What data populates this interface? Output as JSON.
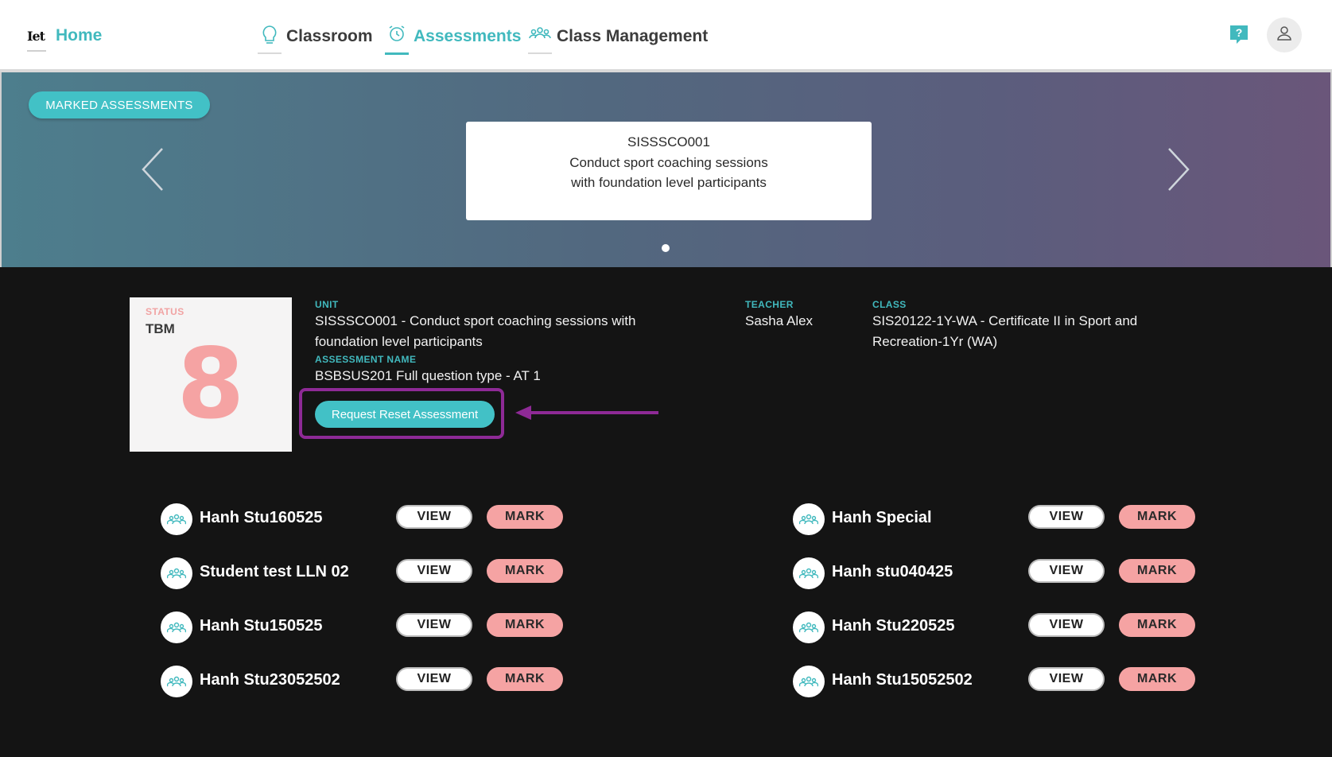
{
  "nav": {
    "logo": "Iet",
    "home": "Home",
    "items": [
      {
        "label": "Classroom",
        "icon": "lightbulb-icon",
        "active": false
      },
      {
        "label": "Assessments",
        "icon": "alarm-clock-icon",
        "active": true
      },
      {
        "label": "Class Management",
        "icon": "users-group-icon",
        "active": false
      }
    ],
    "help_icon": "help-question-icon",
    "avatar_icon": "user-icon"
  },
  "banner": {
    "button": "MARKED ASSESSMENTS",
    "card": {
      "code": "SISSSCO001",
      "description": "Conduct sport coaching sessions with foundation level participants"
    }
  },
  "status": {
    "label": "STATUS",
    "value": "TBM",
    "count": "8"
  },
  "details": {
    "unit_label": "UNIT",
    "unit_value": "SISSSCO001 - Conduct sport coaching sessions with foundation level participants",
    "assessment_label": "ASSESSMENT NAME",
    "assessment_value": "BSBSUS201 Full question type - AT 1",
    "teacher_label": "TEACHER",
    "teacher_value": "Sasha Alex",
    "class_label": "CLASS",
    "class_value": "SIS20122-1Y-WA - Certificate II in Sport and Recreation-1Yr (WA)",
    "reset_button": "Request Reset Assessment"
  },
  "students": {
    "view_label": "VIEW",
    "mark_label": "MARK",
    "left": [
      "Hanh Stu160525",
      "Student test LLN 02",
      "Hanh Stu150525",
      "Hanh Stu23052502"
    ],
    "right": [
      "Hanh Special",
      "Hanh stu040425",
      "Hanh Stu220525",
      "Hanh Stu15052502"
    ]
  },
  "colors": {
    "accent": "#41b9be",
    "mark": "#f5a3a3",
    "highlight": "#8e2a96",
    "panel": "#141414"
  }
}
